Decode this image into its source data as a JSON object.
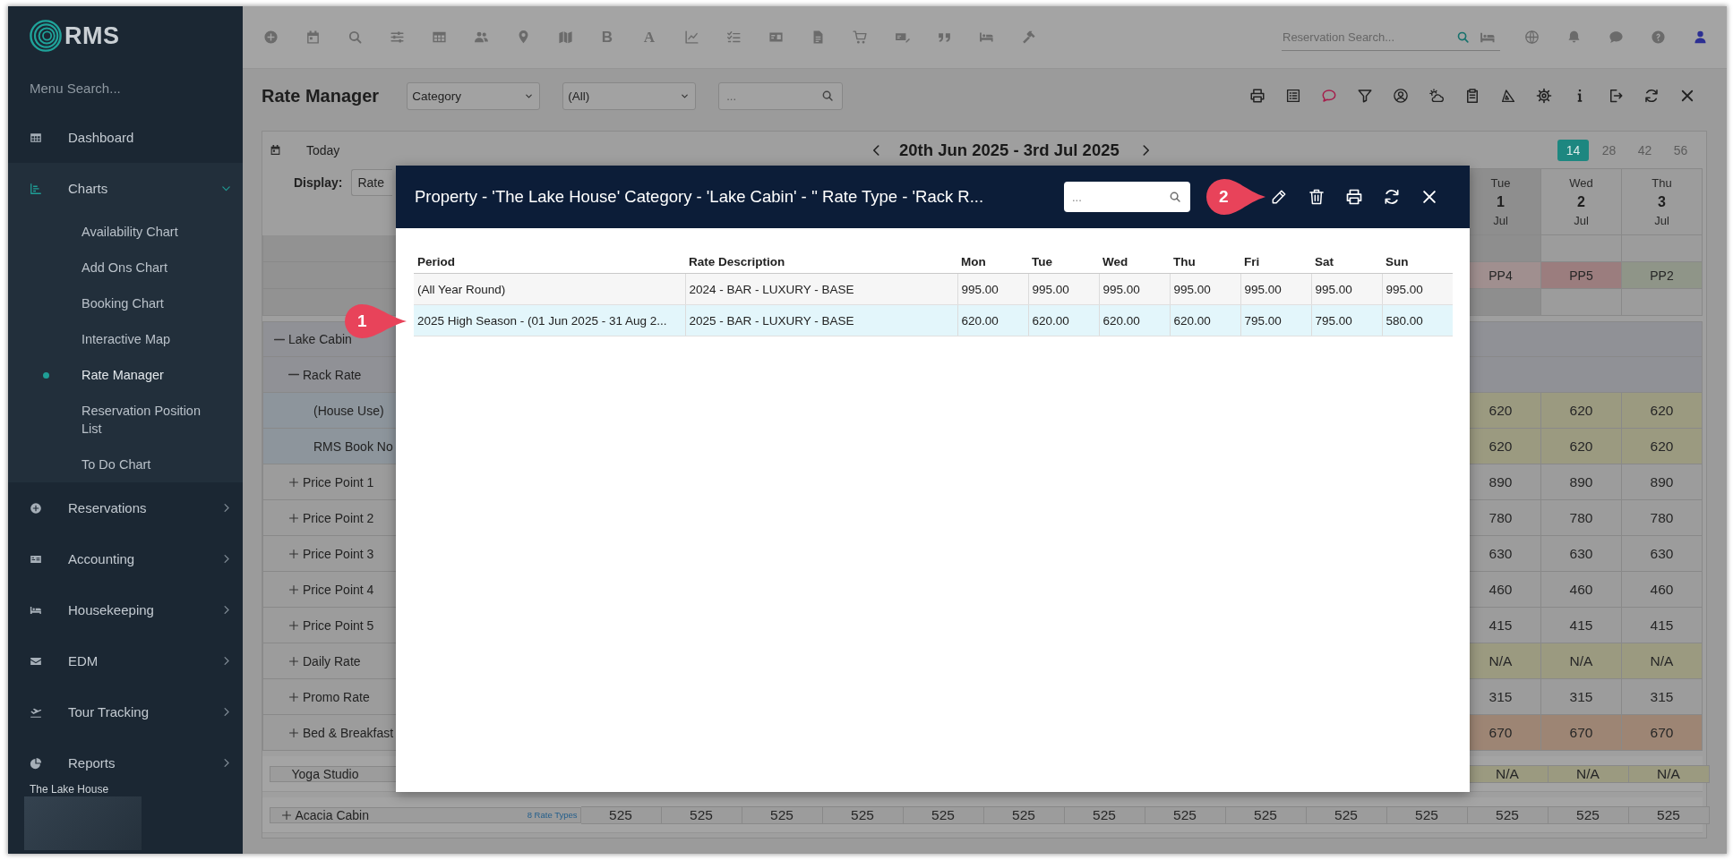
{
  "sidebar": {
    "logo": "RMS",
    "search": {
      "placeholder": "Menu Search..."
    },
    "menu": [
      {
        "label": "Dashboard"
      },
      {
        "label": "Charts",
        "expanded": true,
        "children": [
          {
            "label": "Availability Chart",
            "selected": false
          },
          {
            "label": "Add Ons Chart",
            "selected": false
          },
          {
            "label": "Booking Chart",
            "selected": false
          },
          {
            "label": "Interactive Map",
            "selected": false
          },
          {
            "label": "Rate Manager",
            "selected": true
          },
          {
            "label": "Reservation Position List",
            "selected": false
          },
          {
            "label": "To Do Chart",
            "selected": false
          }
        ]
      },
      {
        "label": "Reservations",
        "expanded": false
      },
      {
        "label": "Accounting",
        "expanded": false
      },
      {
        "label": "Housekeeping",
        "expanded": false
      },
      {
        "label": "EDM",
        "expanded": false
      },
      {
        "label": "Tour Tracking",
        "expanded": false
      },
      {
        "label": "Reports",
        "expanded": false
      }
    ],
    "property": "The Lake House"
  },
  "toolbar": {
    "glyphs": [
      "B",
      "A"
    ],
    "reservation_search": {
      "placeholder": "Reservation Search..."
    }
  },
  "page": {
    "title": "Rate Manager",
    "filters": [
      {
        "value": "Category"
      },
      {
        "value": "(All)"
      }
    ],
    "search": {
      "placeholder": "..."
    }
  },
  "grid": {
    "today": "Today",
    "range": "20th Jun 2025 - 3rd Jul 2025",
    "spans": [
      {
        "label": "14",
        "selected": true
      },
      {
        "label": "28",
        "selected": false
      },
      {
        "label": "42",
        "selected": false
      },
      {
        "label": "56",
        "selected": false
      }
    ],
    "display": {
      "label": "Display:",
      "value": "Rate"
    },
    "dates": [
      {
        "weekday": "Tue",
        "day": "1",
        "month": "Jul",
        "shaded": true
      },
      {
        "weekday": "Wed",
        "day": "2",
        "month": "Jul",
        "shaded": false
      },
      {
        "weekday": "Thu",
        "day": "3",
        "month": "Jul",
        "shaded": false
      }
    ],
    "price_points": [
      {
        "label": "PP4",
        "color": "#a08f8f"
      },
      {
        "label": "PP5",
        "color": "#9b7d7e"
      },
      {
        "label": "PP2",
        "color": "#8f9588"
      }
    ],
    "rows": [
      {
        "label": "Lake Cabin",
        "expanded": true,
        "children": [
          {
            "label": "Rack Rate",
            "expanded": true,
            "children": [
              {
                "label": "(House Use)",
                "values": [
                  "620",
                  "620",
                  "620"
                ],
                "color": "#9b9a80"
              },
              {
                "label": "RMS Book No",
                "values": [
                  "620",
                  "620",
                  "620"
                ],
                "color": "#9b9a80"
              }
            ]
          },
          {
            "label": "Price Point 1",
            "expanded": false,
            "values": [
              "890",
              "890",
              "890"
            ]
          },
          {
            "label": "Price Point 2",
            "expanded": false,
            "values": [
              "780",
              "780",
              "780"
            ]
          },
          {
            "label": "Price Point 3",
            "expanded": false,
            "values": [
              "630",
              "630",
              "630"
            ]
          },
          {
            "label": "Price Point 4",
            "expanded": false,
            "values": [
              "460",
              "460",
              "460"
            ]
          },
          {
            "label": "Price Point 5",
            "expanded": false,
            "values": [
              "415",
              "415",
              "415"
            ]
          },
          {
            "label": "Daily Rate",
            "expanded": false,
            "values": [
              "N/A",
              "N/A",
              "N/A"
            ],
            "color": "#9b9a80"
          },
          {
            "label": "Promo Rate",
            "expanded": false,
            "values": [
              "315",
              "315",
              "315"
            ]
          },
          {
            "label": "Bed & Breakfast",
            "expanded": false,
            "values": [
              "670",
              "670",
              "670"
            ],
            "color": "#9d8574"
          }
        ]
      },
      {
        "label": "Yoga Studio",
        "values": [
          "N/A",
          "N/A",
          "N/A"
        ],
        "color": "#9b9a80"
      },
      {
        "label": "Acacia Cabin",
        "expanded": false,
        "link": "8 Rate Types",
        "values": [
          "525",
          "525",
          "525",
          "525",
          "525",
          "525",
          "525",
          "525",
          "525",
          "525",
          "525",
          "525",
          "525",
          "525"
        ]
      }
    ]
  },
  "modal": {
    "title": "Property - 'The Lake House' Category - 'Lake Cabin' - '' Rate Type - 'Rack R...",
    "search": {
      "placeholder": "..."
    },
    "table": {
      "columns": [
        "Period",
        "Rate Description",
        "Mon",
        "Tue",
        "Wed",
        "Thu",
        "Fri",
        "Sat",
        "Sun"
      ],
      "rows": [
        {
          "selected": false,
          "cells": [
            "(All Year Round)",
            "2024 - BAR - LUXURY - BASE",
            "995.00",
            "995.00",
            "995.00",
            "995.00",
            "995.00",
            "995.00",
            "995.00"
          ]
        },
        {
          "selected": true,
          "cells": [
            "2025 High Season - (01 Jun 2025 - 31 Aug 2...",
            "2025 - BAR - LUXURY - BASE",
            "620.00",
            "620.00",
            "620.00",
            "620.00",
            "795.00",
            "795.00",
            "580.00"
          ]
        }
      ]
    }
  },
  "callouts": [
    {
      "label": "1"
    },
    {
      "label": "2"
    }
  ]
}
